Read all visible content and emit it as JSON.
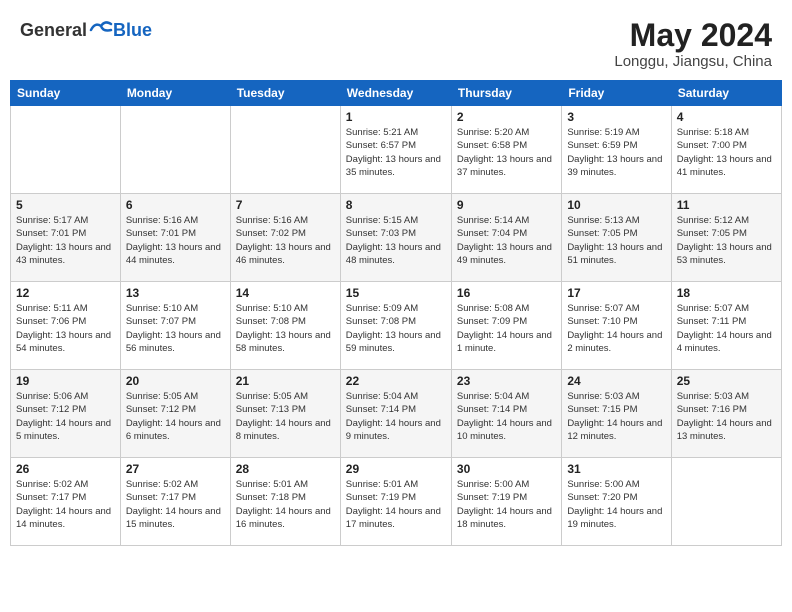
{
  "header": {
    "logo_general": "General",
    "logo_blue": "Blue",
    "month": "May 2024",
    "location": "Longgu, Jiangsu, China"
  },
  "weekdays": [
    "Sunday",
    "Monday",
    "Tuesday",
    "Wednesday",
    "Thursday",
    "Friday",
    "Saturday"
  ],
  "weeks": [
    [
      {
        "day": "",
        "sunrise": "",
        "sunset": "",
        "daylight": ""
      },
      {
        "day": "",
        "sunrise": "",
        "sunset": "",
        "daylight": ""
      },
      {
        "day": "",
        "sunrise": "",
        "sunset": "",
        "daylight": ""
      },
      {
        "day": "1",
        "sunrise": "Sunrise: 5:21 AM",
        "sunset": "Sunset: 6:57 PM",
        "daylight": "Daylight: 13 hours and 35 minutes."
      },
      {
        "day": "2",
        "sunrise": "Sunrise: 5:20 AM",
        "sunset": "Sunset: 6:58 PM",
        "daylight": "Daylight: 13 hours and 37 minutes."
      },
      {
        "day": "3",
        "sunrise": "Sunrise: 5:19 AM",
        "sunset": "Sunset: 6:59 PM",
        "daylight": "Daylight: 13 hours and 39 minutes."
      },
      {
        "day": "4",
        "sunrise": "Sunrise: 5:18 AM",
        "sunset": "Sunset: 7:00 PM",
        "daylight": "Daylight: 13 hours and 41 minutes."
      }
    ],
    [
      {
        "day": "5",
        "sunrise": "Sunrise: 5:17 AM",
        "sunset": "Sunset: 7:01 PM",
        "daylight": "Daylight: 13 hours and 43 minutes."
      },
      {
        "day": "6",
        "sunrise": "Sunrise: 5:16 AM",
        "sunset": "Sunset: 7:01 PM",
        "daylight": "Daylight: 13 hours and 44 minutes."
      },
      {
        "day": "7",
        "sunrise": "Sunrise: 5:16 AM",
        "sunset": "Sunset: 7:02 PM",
        "daylight": "Daylight: 13 hours and 46 minutes."
      },
      {
        "day": "8",
        "sunrise": "Sunrise: 5:15 AM",
        "sunset": "Sunset: 7:03 PM",
        "daylight": "Daylight: 13 hours and 48 minutes."
      },
      {
        "day": "9",
        "sunrise": "Sunrise: 5:14 AM",
        "sunset": "Sunset: 7:04 PM",
        "daylight": "Daylight: 13 hours and 49 minutes."
      },
      {
        "day": "10",
        "sunrise": "Sunrise: 5:13 AM",
        "sunset": "Sunset: 7:05 PM",
        "daylight": "Daylight: 13 hours and 51 minutes."
      },
      {
        "day": "11",
        "sunrise": "Sunrise: 5:12 AM",
        "sunset": "Sunset: 7:05 PM",
        "daylight": "Daylight: 13 hours and 53 minutes."
      }
    ],
    [
      {
        "day": "12",
        "sunrise": "Sunrise: 5:11 AM",
        "sunset": "Sunset: 7:06 PM",
        "daylight": "Daylight: 13 hours and 54 minutes."
      },
      {
        "day": "13",
        "sunrise": "Sunrise: 5:10 AM",
        "sunset": "Sunset: 7:07 PM",
        "daylight": "Daylight: 13 hours and 56 minutes."
      },
      {
        "day": "14",
        "sunrise": "Sunrise: 5:10 AM",
        "sunset": "Sunset: 7:08 PM",
        "daylight": "Daylight: 13 hours and 58 minutes."
      },
      {
        "day": "15",
        "sunrise": "Sunrise: 5:09 AM",
        "sunset": "Sunset: 7:08 PM",
        "daylight": "Daylight: 13 hours and 59 minutes."
      },
      {
        "day": "16",
        "sunrise": "Sunrise: 5:08 AM",
        "sunset": "Sunset: 7:09 PM",
        "daylight": "Daylight: 14 hours and 1 minute."
      },
      {
        "day": "17",
        "sunrise": "Sunrise: 5:07 AM",
        "sunset": "Sunset: 7:10 PM",
        "daylight": "Daylight: 14 hours and 2 minutes."
      },
      {
        "day": "18",
        "sunrise": "Sunrise: 5:07 AM",
        "sunset": "Sunset: 7:11 PM",
        "daylight": "Daylight: 14 hours and 4 minutes."
      }
    ],
    [
      {
        "day": "19",
        "sunrise": "Sunrise: 5:06 AM",
        "sunset": "Sunset: 7:12 PM",
        "daylight": "Daylight: 14 hours and 5 minutes."
      },
      {
        "day": "20",
        "sunrise": "Sunrise: 5:05 AM",
        "sunset": "Sunset: 7:12 PM",
        "daylight": "Daylight: 14 hours and 6 minutes."
      },
      {
        "day": "21",
        "sunrise": "Sunrise: 5:05 AM",
        "sunset": "Sunset: 7:13 PM",
        "daylight": "Daylight: 14 hours and 8 minutes."
      },
      {
        "day": "22",
        "sunrise": "Sunrise: 5:04 AM",
        "sunset": "Sunset: 7:14 PM",
        "daylight": "Daylight: 14 hours and 9 minutes."
      },
      {
        "day": "23",
        "sunrise": "Sunrise: 5:04 AM",
        "sunset": "Sunset: 7:14 PM",
        "daylight": "Daylight: 14 hours and 10 minutes."
      },
      {
        "day": "24",
        "sunrise": "Sunrise: 5:03 AM",
        "sunset": "Sunset: 7:15 PM",
        "daylight": "Daylight: 14 hours and 12 minutes."
      },
      {
        "day": "25",
        "sunrise": "Sunrise: 5:03 AM",
        "sunset": "Sunset: 7:16 PM",
        "daylight": "Daylight: 14 hours and 13 minutes."
      }
    ],
    [
      {
        "day": "26",
        "sunrise": "Sunrise: 5:02 AM",
        "sunset": "Sunset: 7:17 PM",
        "daylight": "Daylight: 14 hours and 14 minutes."
      },
      {
        "day": "27",
        "sunrise": "Sunrise: 5:02 AM",
        "sunset": "Sunset: 7:17 PM",
        "daylight": "Daylight: 14 hours and 15 minutes."
      },
      {
        "day": "28",
        "sunrise": "Sunrise: 5:01 AM",
        "sunset": "Sunset: 7:18 PM",
        "daylight": "Daylight: 14 hours and 16 minutes."
      },
      {
        "day": "29",
        "sunrise": "Sunrise: 5:01 AM",
        "sunset": "Sunset: 7:19 PM",
        "daylight": "Daylight: 14 hours and 17 minutes."
      },
      {
        "day": "30",
        "sunrise": "Sunrise: 5:00 AM",
        "sunset": "Sunset: 7:19 PM",
        "daylight": "Daylight: 14 hours and 18 minutes."
      },
      {
        "day": "31",
        "sunrise": "Sunrise: 5:00 AM",
        "sunset": "Sunset: 7:20 PM",
        "daylight": "Daylight: 14 hours and 19 minutes."
      },
      {
        "day": "",
        "sunrise": "",
        "sunset": "",
        "daylight": ""
      }
    ]
  ]
}
